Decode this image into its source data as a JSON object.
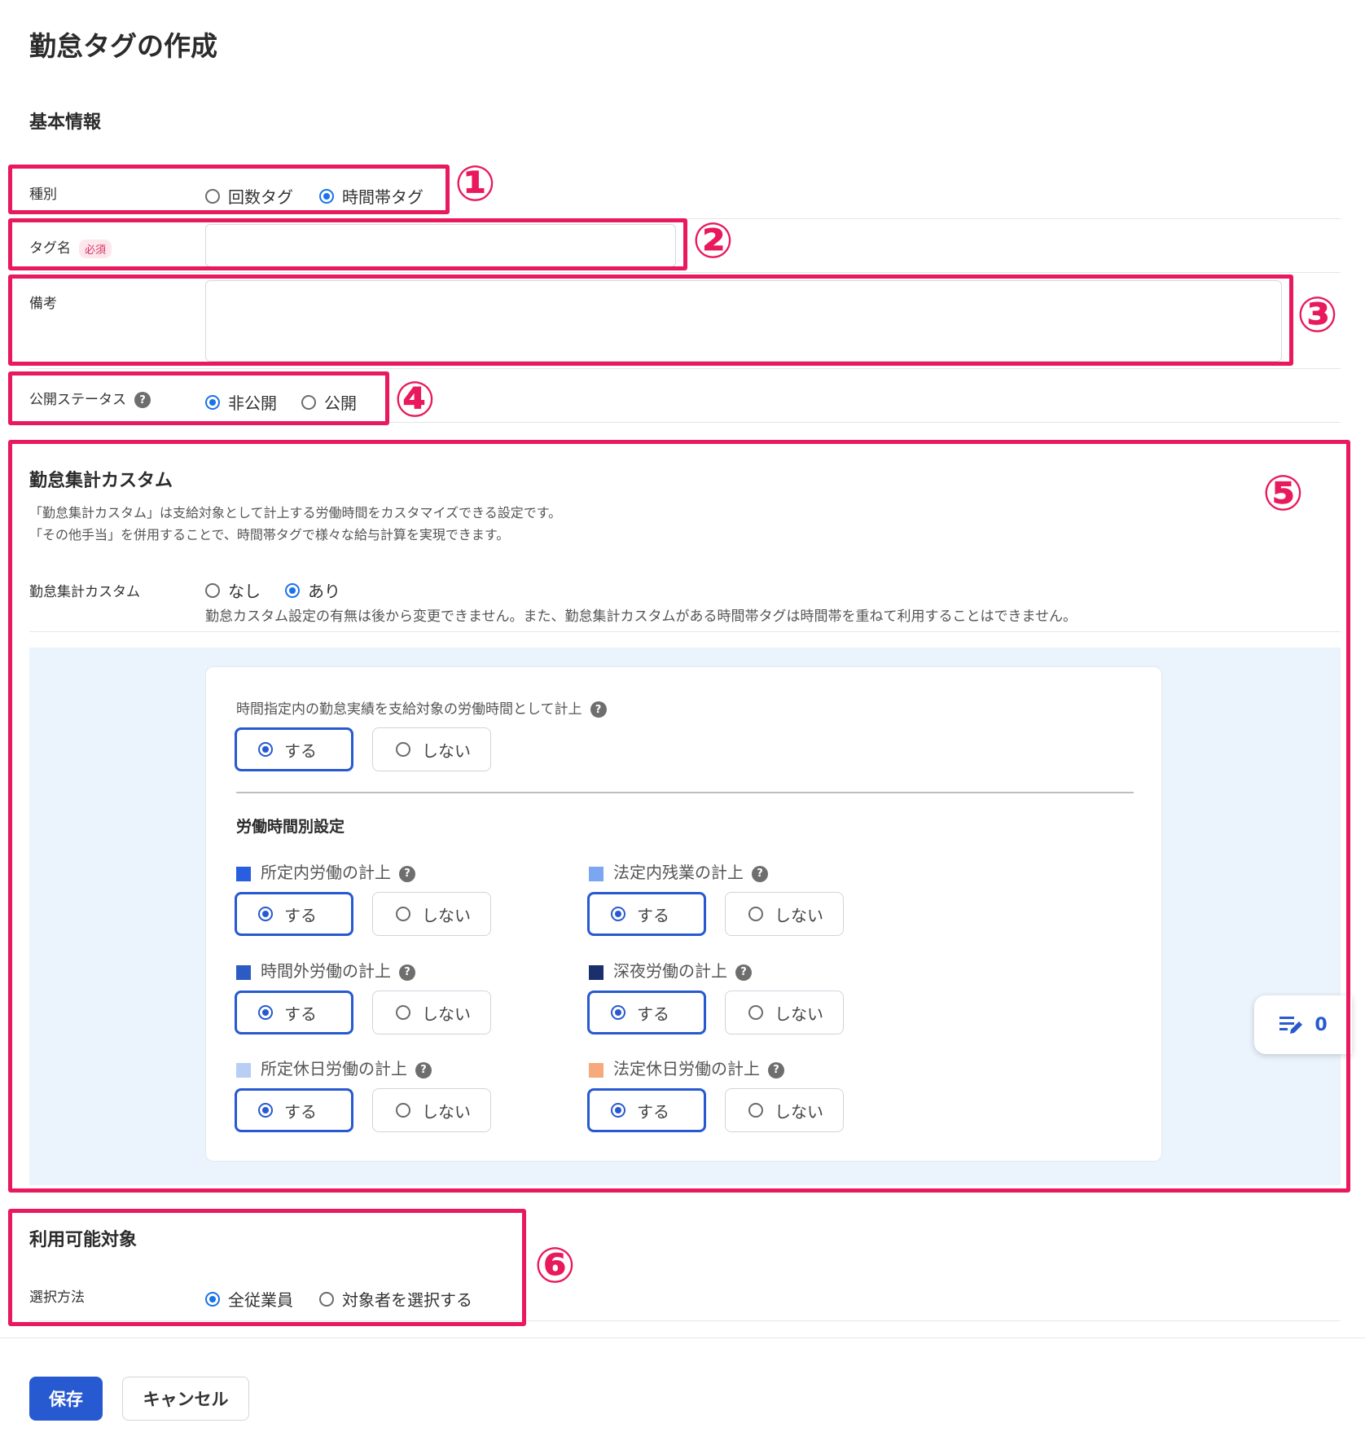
{
  "page_title": "勤怠タグの作成",
  "basic": {
    "title": "基本情報",
    "type": {
      "label": "種別",
      "options": [
        "回数タグ",
        "時間帯タグ"
      ],
      "selected": "時間帯タグ"
    },
    "tag_name": {
      "label": "タグ名",
      "required_badge": "必須",
      "value": ""
    },
    "remarks": {
      "label": "備考",
      "value": ""
    },
    "status": {
      "label": "公開ステータス",
      "options": [
        "非公開",
        "公開"
      ],
      "selected": "非公開"
    }
  },
  "custom": {
    "title": "勤怠集計カスタム",
    "desc_line1": "「勤怠集計カスタム」は支給対象として計上する労働時間をカスタマイズできる設定です。",
    "desc_line2": "「その他手当」を併用することで、時間帯タグで様々な給与計算を実現できます。",
    "setting_label": "勤怠集計カスタム",
    "options": [
      "なし",
      "あり"
    ],
    "selected": "あり",
    "note": "勤怠カスタム設定の有無は後から変更できません。また、勤怠集計カスタムがある時間帯タグは時間帯を重ねて利用することはできません。",
    "main_question": "時間指定内の勤怠実績を支給対象の労働時間として計上",
    "yes_label": "する",
    "no_label": "しない",
    "sub_title": "労働時間別設定",
    "groups": [
      {
        "label": "所定内労働の計上",
        "color": "#2a5ee0",
        "selected": "する"
      },
      {
        "label": "法定内残業の計上",
        "color": "#7aa6f2",
        "selected": "する"
      },
      {
        "label": "時間外労働の計上",
        "color": "#2d5bc4",
        "selected": "する"
      },
      {
        "label": "深夜労働の計上",
        "color": "#1a2f6b",
        "selected": "する"
      },
      {
        "label": "所定休日労働の計上",
        "color": "#b8cef5",
        "selected": "する"
      },
      {
        "label": "法定休日労働の計上",
        "color": "#f6a97a",
        "selected": "する"
      }
    ]
  },
  "availability": {
    "title": "利用可能対象",
    "method_label": "選択方法",
    "options": [
      "全従業員",
      "対象者を選択する"
    ],
    "selected": "全従業員"
  },
  "float_count": "0",
  "buttons": {
    "save": "保存",
    "cancel": "キャンセル"
  },
  "markers": [
    "①",
    "②",
    "③",
    "④",
    "⑤",
    "⑥"
  ],
  "help_glyph": "?"
}
